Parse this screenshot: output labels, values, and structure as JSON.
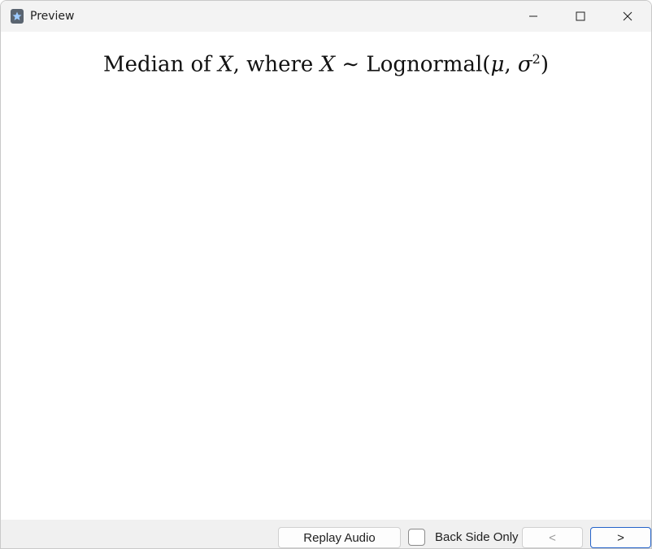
{
  "window": {
    "title": "Preview",
    "icons": {
      "app": "anki-star-icon",
      "minimize": "minimize-icon",
      "maximize": "maximize-icon",
      "close": "close-icon"
    }
  },
  "card": {
    "formula_parts": {
      "prefix": "Median of ",
      "var1": "X",
      "comma": ", ",
      "where": " where ",
      "var2": "X",
      "tilde": " ∼ ",
      "dist": "Lognormal(",
      "mu": "μ",
      "sep": ", ",
      "sigma": "σ",
      "exp": "2",
      "close": ")"
    }
  },
  "footer": {
    "replay_audio_label": "Replay Audio",
    "back_side_only_label": "Back Side Only",
    "back_side_only_checked": false,
    "prev_label": "<",
    "next_label": ">"
  }
}
